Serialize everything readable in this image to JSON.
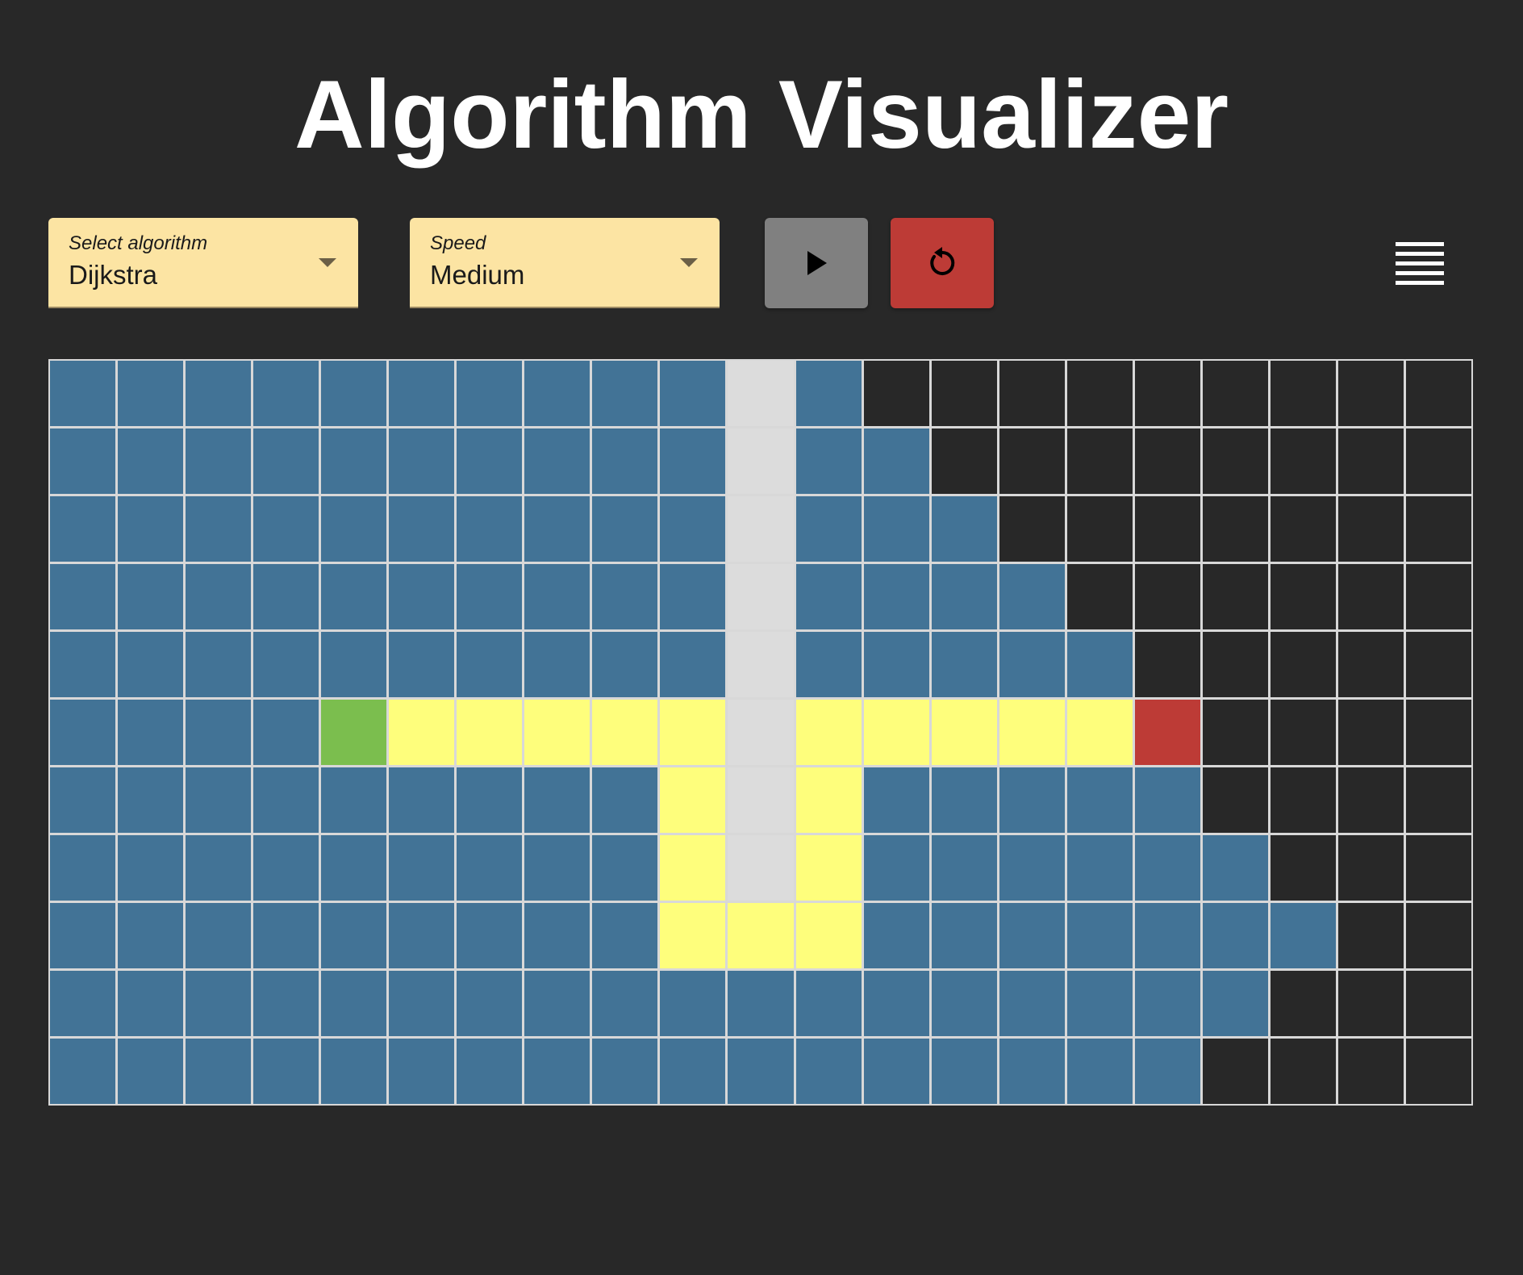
{
  "header": {
    "title": "Algorithm Visualizer"
  },
  "controls": {
    "algorithm": {
      "label": "Select algorithm",
      "value": "Dijkstra"
    },
    "speed": {
      "label": "Speed",
      "value": "Medium"
    },
    "play_button_icon": "play-icon",
    "reset_button_icon": "reset-icon",
    "menu_icon": "hamburger-menu-icon"
  },
  "colors": {
    "background": "#282828",
    "visited": "#427396",
    "unvisited": "#282828",
    "wall": "#dcdcdc",
    "path": "#fefe7c",
    "start": "#7bbe4e",
    "end": "#bd3b36",
    "select_bg": "#fce4a3",
    "play_bg": "#808080",
    "reset_bg": "#bd3b36"
  },
  "grid": {
    "rows": 11,
    "cols": 21,
    "legend": {
      "V": "visited",
      "U": "unvisited",
      "W": "wall",
      "P": "path",
      "S": "start",
      "E": "end"
    },
    "cells": [
      "VVVVVVVVVVWVUUUUUUUUU",
      "VVVVVVVVVVWVVUUUUUUUU",
      "VVVVVVVVVVWVVVUUUUUUU",
      "VVVVVVVVVVWVVVVUUUUUU",
      "VVVVVVVVVVWVVVVVUUUUU",
      "VVVVSPPPPPWPPPPPEUUUU",
      "VVVVVVVVVPWPVVVVVUUUU",
      "VVVVVVVVVPWPVVVVVVUUU",
      "VVVVVVVVVPPPVVVVVVVUU",
      "VVVVVVVVVVVVVVVVVVUUU",
      "VVVVVVVVVVVVVVVVVUUUU"
    ]
  }
}
